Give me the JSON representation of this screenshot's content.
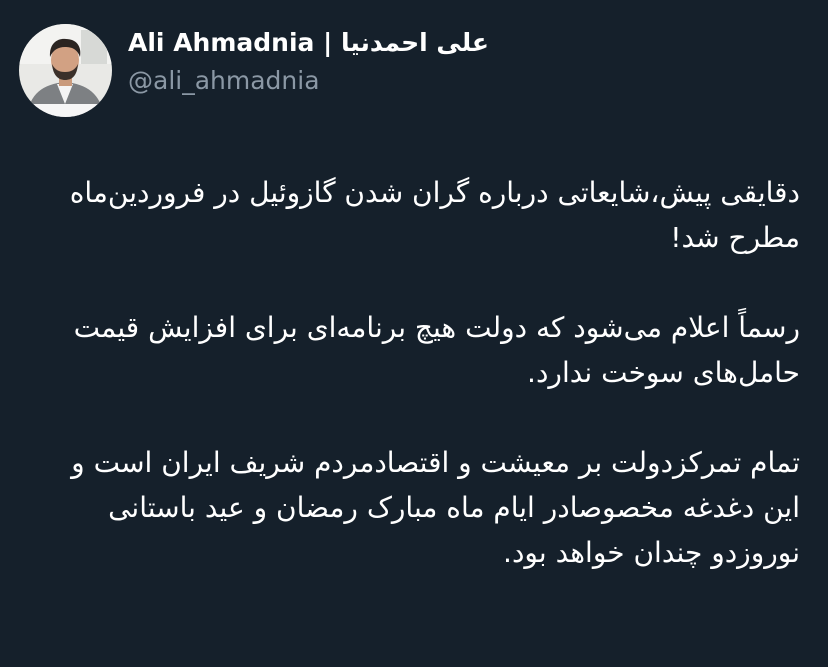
{
  "author": {
    "display_name": "Ali Ahmadnia | علی احمدنیا",
    "handle": "@ali_ahmadnia",
    "avatar_icon": "profile-photo"
  },
  "tweet": {
    "paragraphs": [
      "دقایقی پیش،شایعاتی درباره گران شدن گازوئیل در فروردین‌ماه مطرح شد!",
      "رسماً اعلام می‌شود که دولت هیچ برنامه‌ای برای افزایش قیمت حامل‌های سوخت ندارد.",
      "تمام تمرکزدولت بر معیشت و اقتصادمردم شریف ایران است و این دغدغه مخصوصادر ایام ماه مبارک رمضان و عید باستانی نوروزدو چندان خواهد بود."
    ]
  },
  "colors": {
    "background": "#15202b",
    "primary_text": "#ffffff",
    "secondary_text": "#8b98a5"
  }
}
